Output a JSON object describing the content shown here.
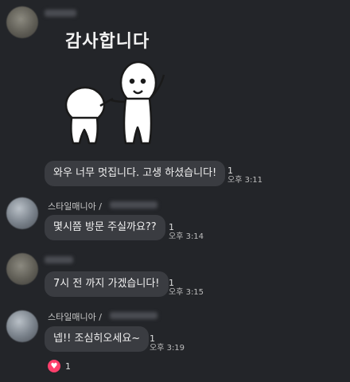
{
  "sticker": {
    "title": "감사합니다"
  },
  "messages": [
    {
      "text": "와우 너무 멋집니다. 고생 하셨습니다!",
      "count": "1",
      "time": "오후 3:11"
    },
    {
      "sender": "스타일매니아 /",
      "text": "몇시쯤 방문 주실까요??",
      "count": "1",
      "time": "오후 3:14"
    },
    {
      "text": "7시 전 까지 가겠습니다!",
      "count": "1",
      "time": "오후 3:15"
    },
    {
      "sender": "스타일매니아 /",
      "text": "넵!! 조심히오세요~",
      "count": "1",
      "time": "오후 3:19"
    }
  ],
  "reaction": {
    "icon": "heart-icon",
    "count": "1",
    "color": "#ff3f6c"
  }
}
